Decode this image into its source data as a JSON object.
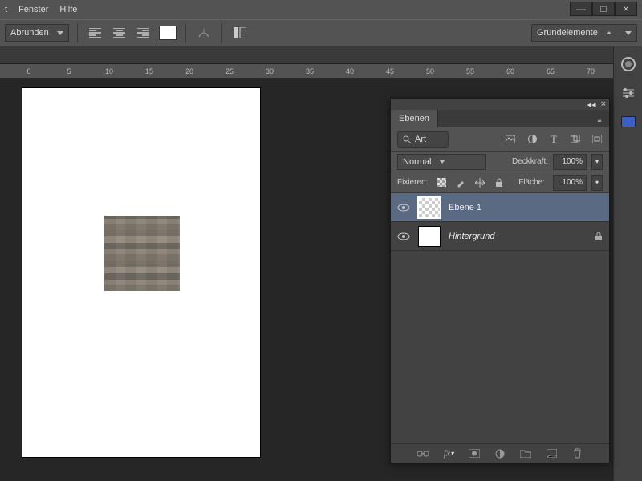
{
  "menu": {
    "items": [
      "t",
      "Fenster",
      "Hilfe"
    ]
  },
  "winctrl": {
    "min": "—",
    "max": "□",
    "close": "×"
  },
  "toolbar": {
    "rounding_label": "Abrunden",
    "workspace_label": "Grundelemente"
  },
  "ruler": {
    "ticks": [
      0,
      5,
      10,
      15,
      20,
      25,
      30,
      35,
      40,
      45,
      50,
      55,
      60,
      65,
      70
    ]
  },
  "panel": {
    "collapse": "◂◂",
    "close": "×",
    "title": "Ebenen",
    "menu_icon": "≡",
    "search_label": "Art",
    "blend_mode": "Normal",
    "opacity_label": "Deckkraft:",
    "opacity_value": "100%",
    "lock_label": "Fixieren:",
    "fill_label": "Fläche:",
    "fill_value": "100%",
    "layers": [
      {
        "name": "Ebene 1",
        "selected": true,
        "transparent": true,
        "locked": false
      },
      {
        "name": "Hintergrund",
        "selected": false,
        "transparent": false,
        "locked": true,
        "italic": true
      }
    ]
  }
}
